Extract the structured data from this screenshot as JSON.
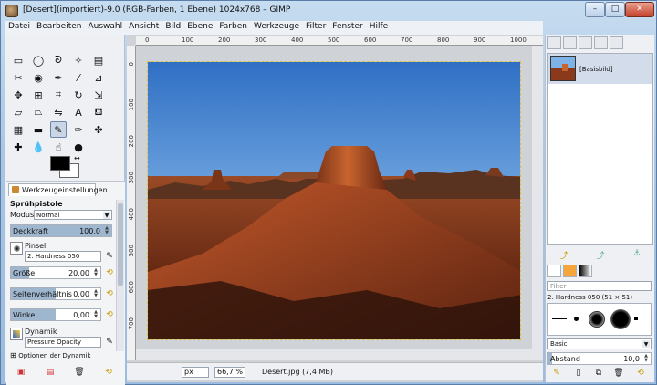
{
  "window": {
    "title": "[Desert](importiert)-9.0 (RGB-Farben, 1 Ebene) 1024x768 – GIMP",
    "min": "–",
    "max": "□",
    "close": "✕"
  },
  "menu": [
    "Datei",
    "Bearbeiten",
    "Auswahl",
    "Ansicht",
    "Bild",
    "Ebene",
    "Farben",
    "Werkzeuge",
    "Filter",
    "Fenster",
    "Hilfe"
  ],
  "toolbox": {
    "tab_label": "Werkzeugeinstellungen",
    "tool_name": "Sprühpistole",
    "mode_label": "Modus:",
    "mode_value": "Normal",
    "opacity_label": "Deckkraft",
    "opacity_value": "100,0",
    "opacity_fraction": 1.0,
    "brush_label": "Pinsel",
    "brush_value": "2. Hardness 050",
    "size_label": "Größe",
    "size_value": "20,00",
    "size_fraction": 0.2,
    "aspect_label": "Seitenverhältnis",
    "aspect_value": "0,00",
    "aspect_fraction": 0.5,
    "angle_label": "Winkel",
    "angle_value": "0,00",
    "angle_fraction": 0.5,
    "dynamics_label": "Dynamik",
    "dynamics_value": "Pressure Opacity",
    "dynamics_options_label": "Optionen der Dynamik",
    "fg_color": "#000000",
    "bg_color": "#ffffff"
  },
  "rulers": {
    "top": [
      "0",
      "100",
      "200",
      "300",
      "400",
      "500",
      "600",
      "700",
      "800",
      "900",
      "1000"
    ],
    "left": [
      "0",
      "100",
      "200",
      "300",
      "400",
      "500",
      "600",
      "700"
    ]
  },
  "status": {
    "unit": "px",
    "zoom": "66,7 %",
    "text": "Desert.jpg (7,4 MB)"
  },
  "dock": {
    "layer_name": "[Basisbild]",
    "brushes_filter_placeholder": "Filter",
    "brush_selected": "2. Hardness 050 (51 × 51)",
    "brush_category": "Basic.",
    "spacing_label": "Abstand",
    "spacing_value": "10,0"
  }
}
